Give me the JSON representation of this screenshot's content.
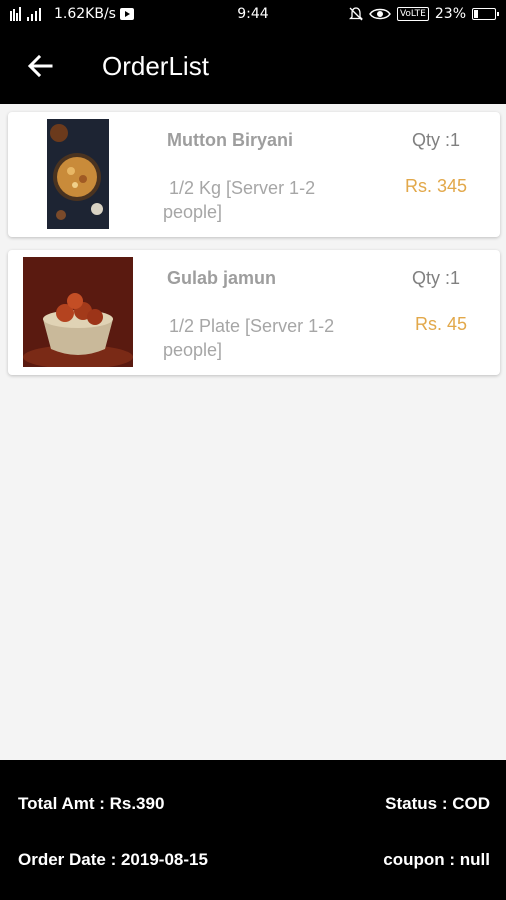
{
  "status_bar": {
    "network_speed": "1.62KB/s",
    "time": "9:44",
    "volte": "VoLTE",
    "battery": "23%",
    "battery_level": 0.23
  },
  "app_bar": {
    "title": "OrderList",
    "back_icon": "arrow-left-icon"
  },
  "orders": [
    {
      "name": "Mutton Biryani",
      "qty": "Qty :1",
      "desc": "1/2 Kg [Server 1-2 people]",
      "price": "Rs. 345"
    },
    {
      "name": "Gulab jamun",
      "qty": "Qty :1",
      "desc": "1/2 Plate [Server 1-2 people]",
      "price": "Rs. 45"
    }
  ],
  "footer": {
    "total": "Total Amt : Rs.390",
    "status": "Status : COD",
    "date": "Order Date : 2019-08-15",
    "coupon": "coupon : null"
  },
  "colors": {
    "bar_bg": "#000000",
    "price": "#e2a84a",
    "item_text": "#9e9e9e"
  }
}
